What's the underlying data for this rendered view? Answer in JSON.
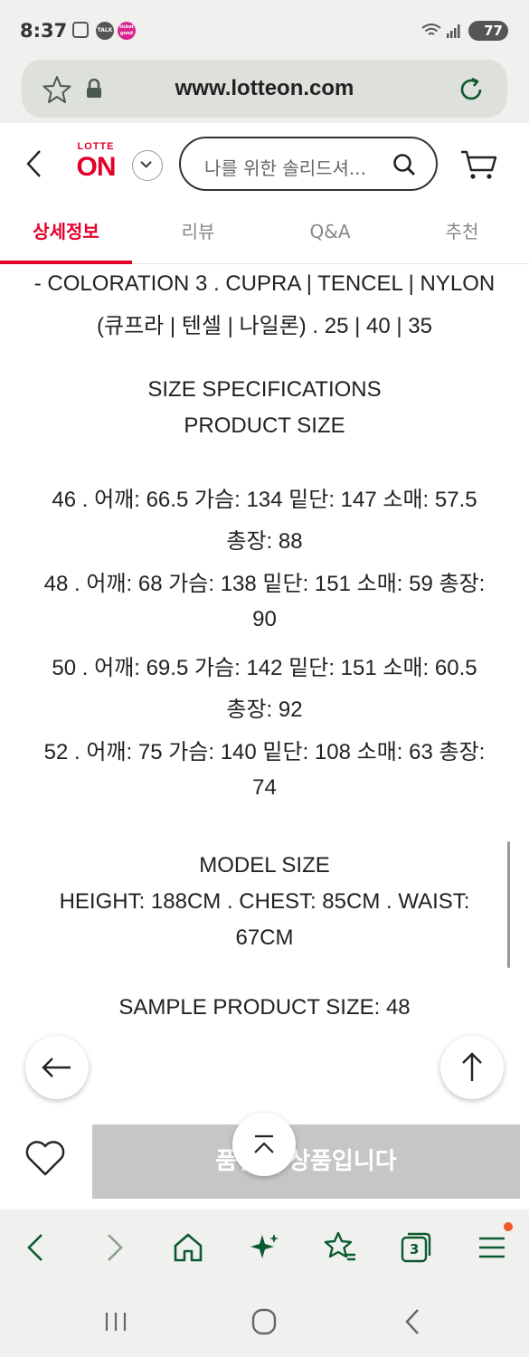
{
  "status_bar": {
    "time": "8:37",
    "talk_label": "TALK",
    "app_badge_label": "ticket good",
    "battery": "77"
  },
  "browser": {
    "url": "www.lotteon.com",
    "tab_count": "3"
  },
  "header": {
    "logo_top": "LOTTE",
    "logo_main": "ON",
    "search_placeholder": "나를 위한 솔리드셔..."
  },
  "tabs": [
    {
      "label": "상세정보",
      "active": true
    },
    {
      "label": "리뷰",
      "active": false
    },
    {
      "label": "Q&A",
      "active": false
    },
    {
      "label": "추천",
      "active": false
    }
  ],
  "content": {
    "lines": [
      "- COLORATION 3 . CUPRA | TENCEL | NYLON",
      "(큐프라 | 텐셀 | 나일론) . 25 | 40 | 35",
      "SIZE SPECIFICATIONS",
      "PRODUCT SIZE",
      "46 . 어깨: 66.5 가슴: 134 밑단: 147 소매: 57.5",
      "총장: 88",
      "48 . 어깨: 68 가슴: 138 밑단: 151 소매: 59 총장:",
      "90",
      "50 . 어깨: 69.5 가슴: 142 밑단: 151 소매: 60.5",
      "총장: 92",
      "52 . 어깨: 75 가슴: 140 밑단: 108 소매: 63 총장:",
      "74",
      "MODEL SIZE",
      "HEIGHT: 188CM . CHEST: 85CM . WAIST:",
      "67CM",
      "SAMPLE PRODUCT SIZE: 48"
    ]
  },
  "purchase": {
    "button_label": "품절된 상품입니다"
  },
  "colors": {
    "brand_red": "#e4002b",
    "browser_green": "#0b5a2e",
    "disabled_gray": "#c6c6c6"
  }
}
